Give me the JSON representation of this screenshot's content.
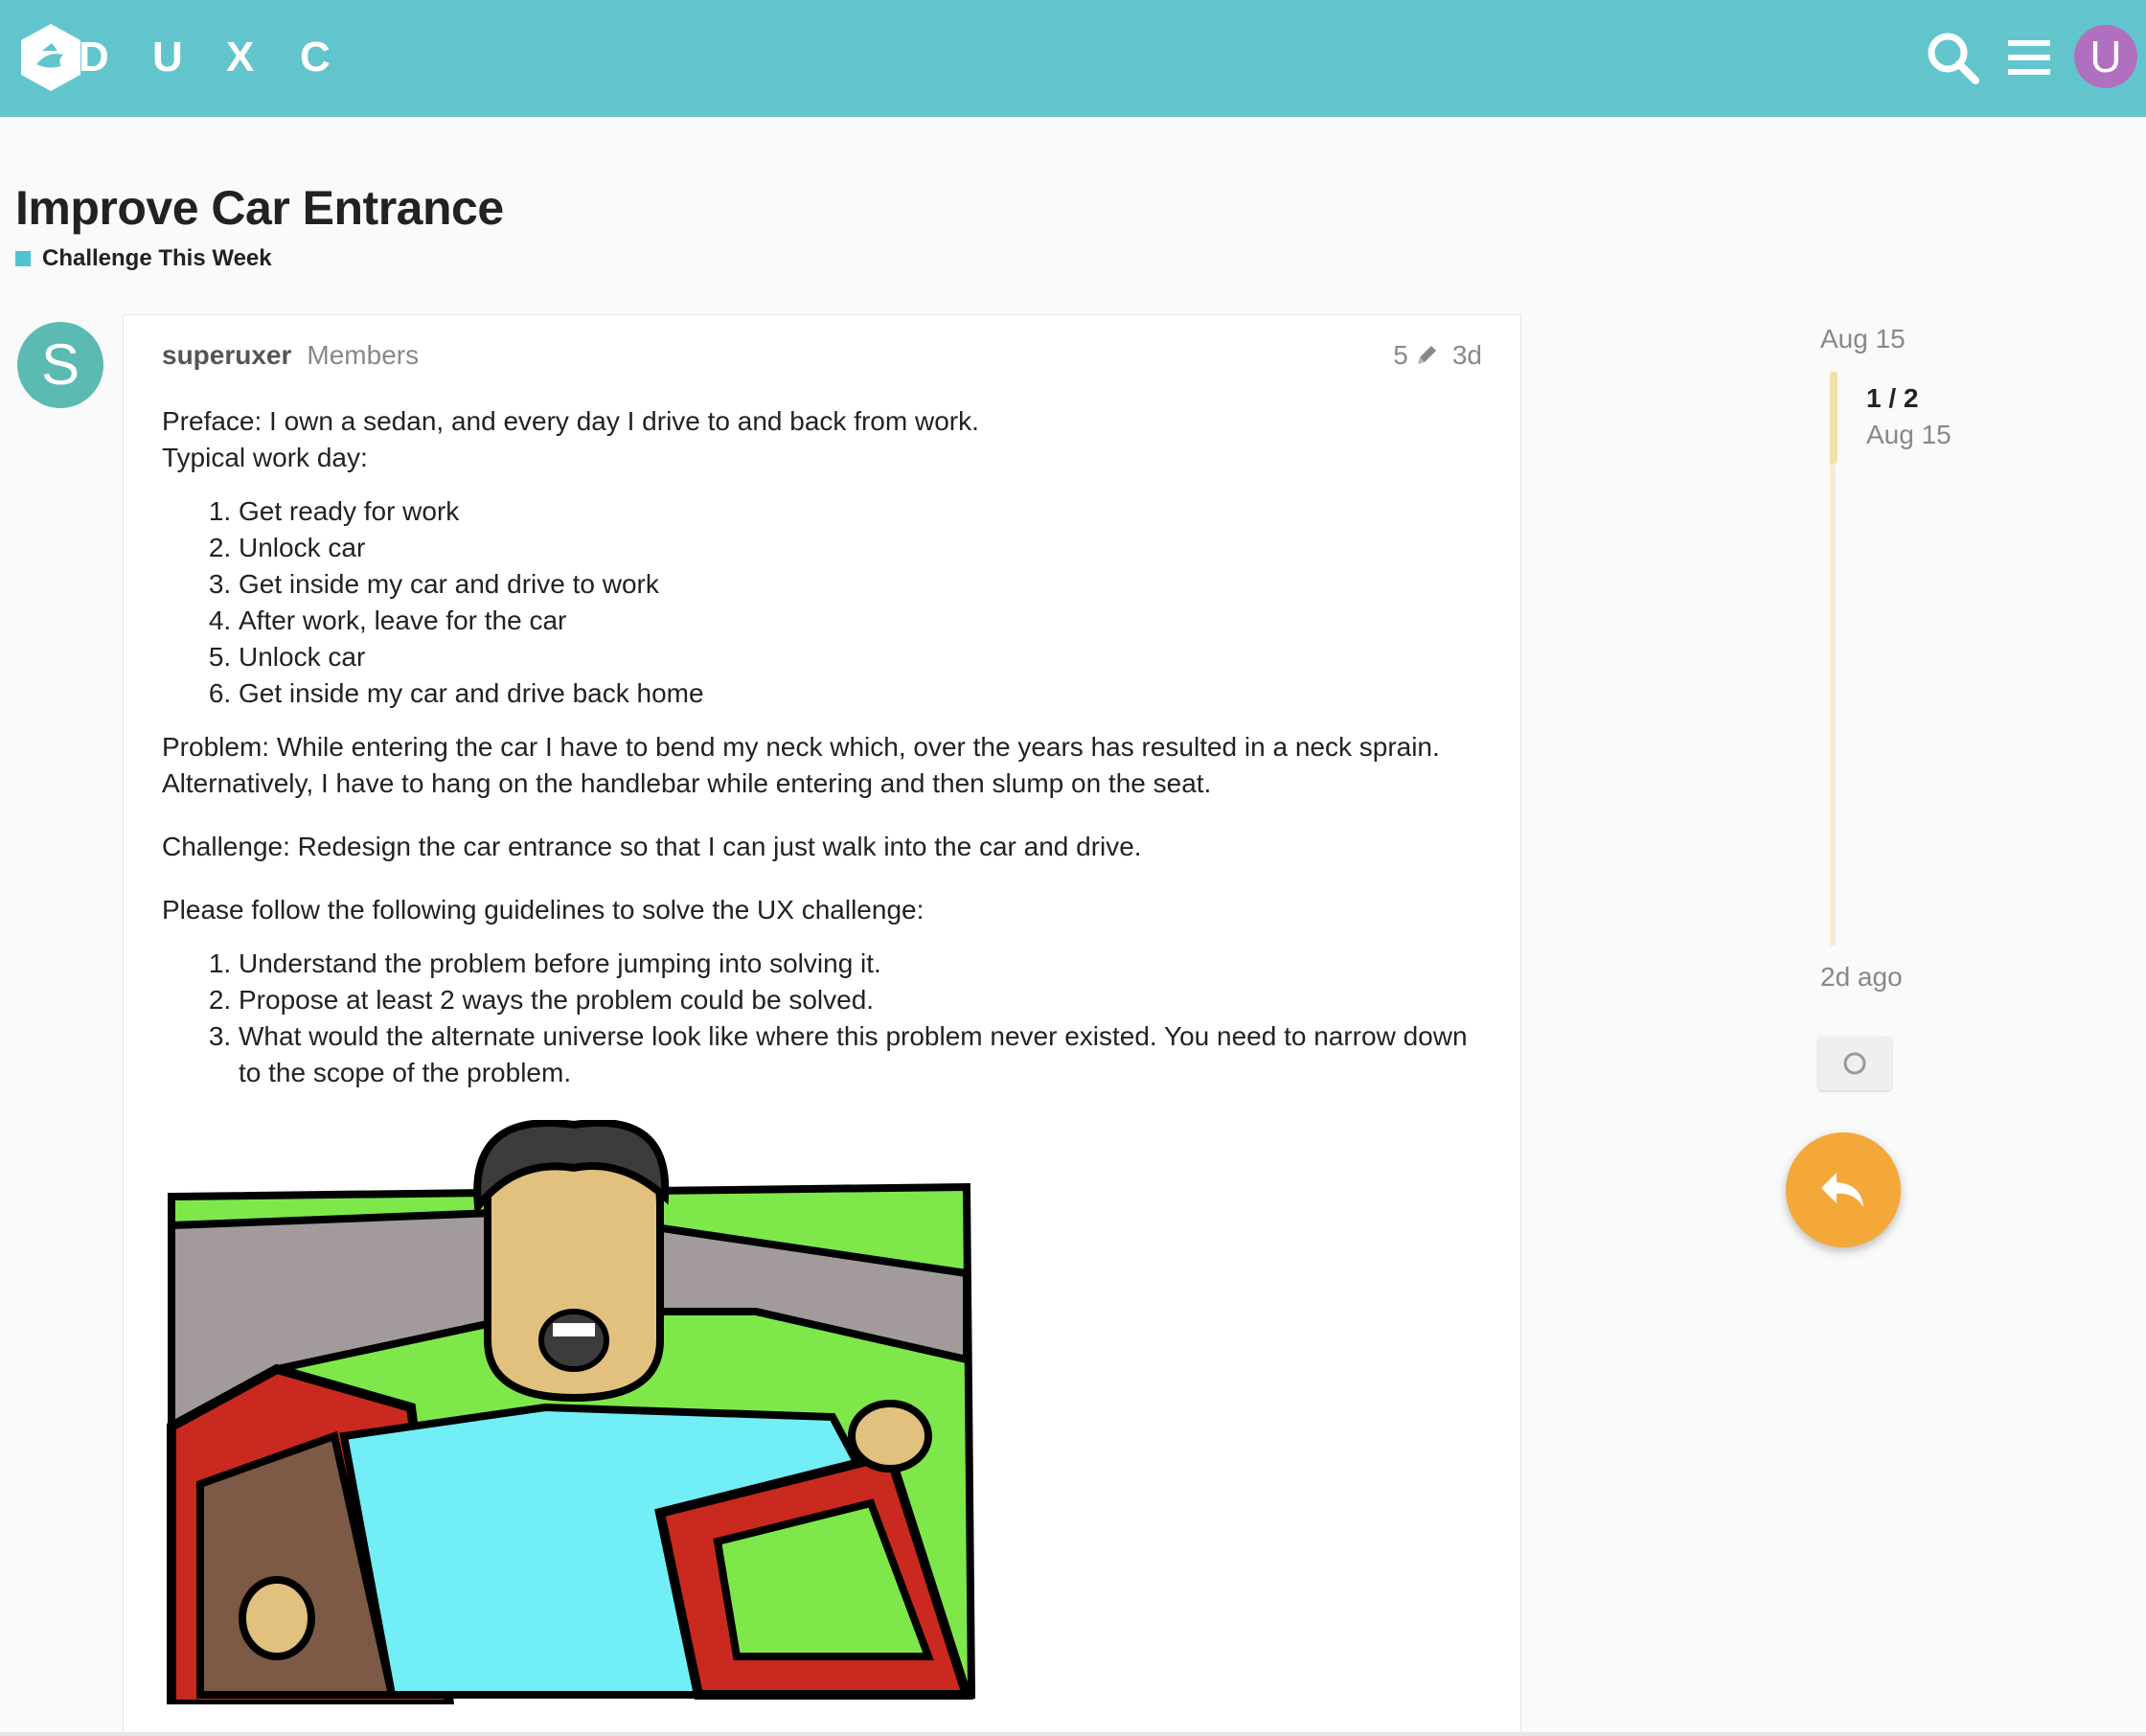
{
  "header": {
    "logo_letters": [
      "D",
      "U",
      "X",
      "C"
    ],
    "avatar_letter": "U",
    "brand_color": "#62c5cd",
    "icons": [
      "logo-hexagon-icon",
      "search-icon",
      "hamburger-menu-icon"
    ]
  },
  "topic": {
    "title": "Improve Car Entrance",
    "category": "Challenge This Week",
    "category_color": "#4ec4cf"
  },
  "post": {
    "avatar_letter": "S",
    "avatar_color": "#5bbab1",
    "username": "superuxer",
    "group": "Members",
    "edit_count": "5",
    "age": "3d",
    "preface": "Preface: I own a sedan, and every day I drive to and back from work.",
    "typical_day_heading": "Typical work day:",
    "typical_day": [
      "Get ready for work",
      "Unlock car",
      "Get inside my car and drive to work",
      "After work, leave for the car",
      "Unlock car",
      "Get inside my car and drive back home"
    ],
    "problem_line1": "Problem: While entering the car I have to bend my neck which, over the years has resulted in a neck sprain.",
    "problem_line2": "Alternatively, I have to hang on the handlebar while entering and then slump on the seat.",
    "challenge": "Challenge: Redesign the car entrance so that I can just walk into the car and drive.",
    "guidelines_heading": "Please follow the following guidelines to solve the UX challenge:",
    "guidelines": [
      "Understand the problem before jumping into solving it.",
      "Propose at least 2 ways the problem could be solved.",
      "What would the alternate universe look like where this problem never existed. You need to narrow down to the scope of the problem."
    ]
  },
  "timeline": {
    "top_date": "Aug 15",
    "counter": "1 / 2",
    "counter_date": "Aug 15",
    "bottom_label": "2d ago"
  },
  "reply_button_color": "#f5a83a"
}
